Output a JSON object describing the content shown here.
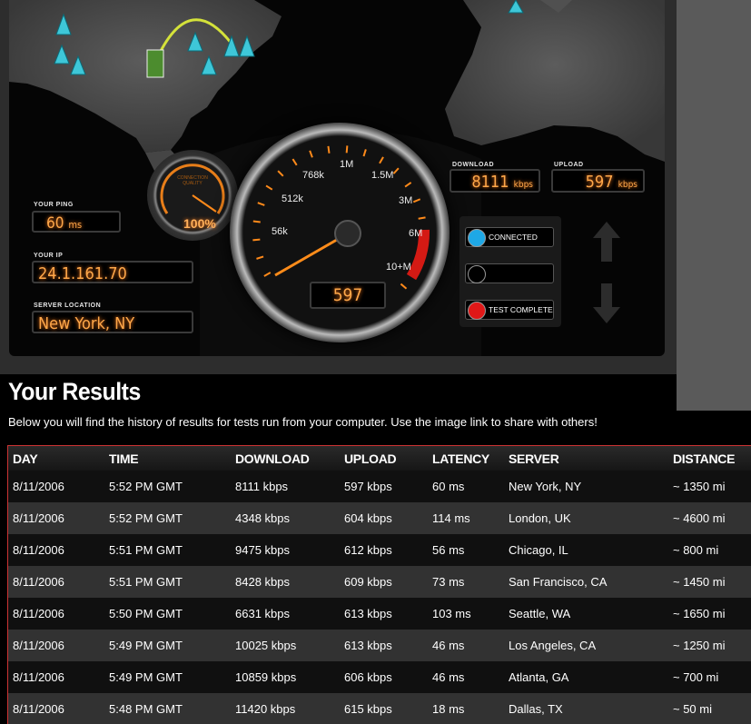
{
  "gauge": {
    "ticks": [
      "56k",
      "512k",
      "768k",
      "1M",
      "1.5M",
      "3M",
      "6M",
      "10+M"
    ],
    "readout": "597"
  },
  "quality": {
    "label": "CONNECTION QUALITY",
    "percent": "100%"
  },
  "ping": {
    "label": "YOUR PING",
    "value": "60",
    "unit": "ms"
  },
  "ip": {
    "label": "YOUR IP",
    "value": "24.1.161.70"
  },
  "server_location": {
    "label": "SERVER LOCATION",
    "value": "New York, NY"
  },
  "download": {
    "label": "DOWNLOAD",
    "value": "8111",
    "unit": "kbps"
  },
  "upload": {
    "label": "UPLOAD",
    "value": "597",
    "unit": "kbps"
  },
  "status": [
    {
      "label": "CONNECTED",
      "color": "#1ea8e6"
    },
    {
      "label": "",
      "color": "#000000"
    },
    {
      "label": "TEST COMPLETE",
      "color": "#e01818"
    }
  ],
  "results": {
    "title": "Your Results",
    "description": "Below you will find the history of results for tests run from your computer. Use the image link to share with others!",
    "columns": [
      "DAY",
      "TIME",
      "DOWNLOAD",
      "UPLOAD",
      "LATENCY",
      "SERVER",
      "DISTANCE"
    ],
    "rows": [
      [
        "8/11/2006",
        "5:52 PM GMT",
        "8111 kbps",
        "597 kbps",
        "60 ms",
        "New York, NY",
        "~ 1350 mi"
      ],
      [
        "8/11/2006",
        "5:52 PM GMT",
        "4348 kbps",
        "604 kbps",
        "114 ms",
        "London, UK",
        "~ 4600 mi"
      ],
      [
        "8/11/2006",
        "5:51 PM GMT",
        "9475 kbps",
        "612 kbps",
        "56 ms",
        "Chicago, IL",
        "~ 800 mi"
      ],
      [
        "8/11/2006",
        "5:51 PM GMT",
        "8428 kbps",
        "609 kbps",
        "73 ms",
        "San Francisco, CA",
        "~ 1450 mi"
      ],
      [
        "8/11/2006",
        "5:50 PM GMT",
        "6631 kbps",
        "613 kbps",
        "103 ms",
        "Seattle, WA",
        "~ 1650 mi"
      ],
      [
        "8/11/2006",
        "5:49 PM GMT",
        "10025 kbps",
        "613 kbps",
        "46 ms",
        "Los Angeles, CA",
        "~ 1250 mi"
      ],
      [
        "8/11/2006",
        "5:49 PM GMT",
        "10859 kbps",
        "606 kbps",
        "46 ms",
        "Atlanta, GA",
        "~ 700 mi"
      ],
      [
        "8/11/2006",
        "5:48 PM GMT",
        "11420 kbps",
        "615 kbps",
        "18 ms",
        "Dallas, TX",
        "~ 50 mi"
      ]
    ]
  }
}
